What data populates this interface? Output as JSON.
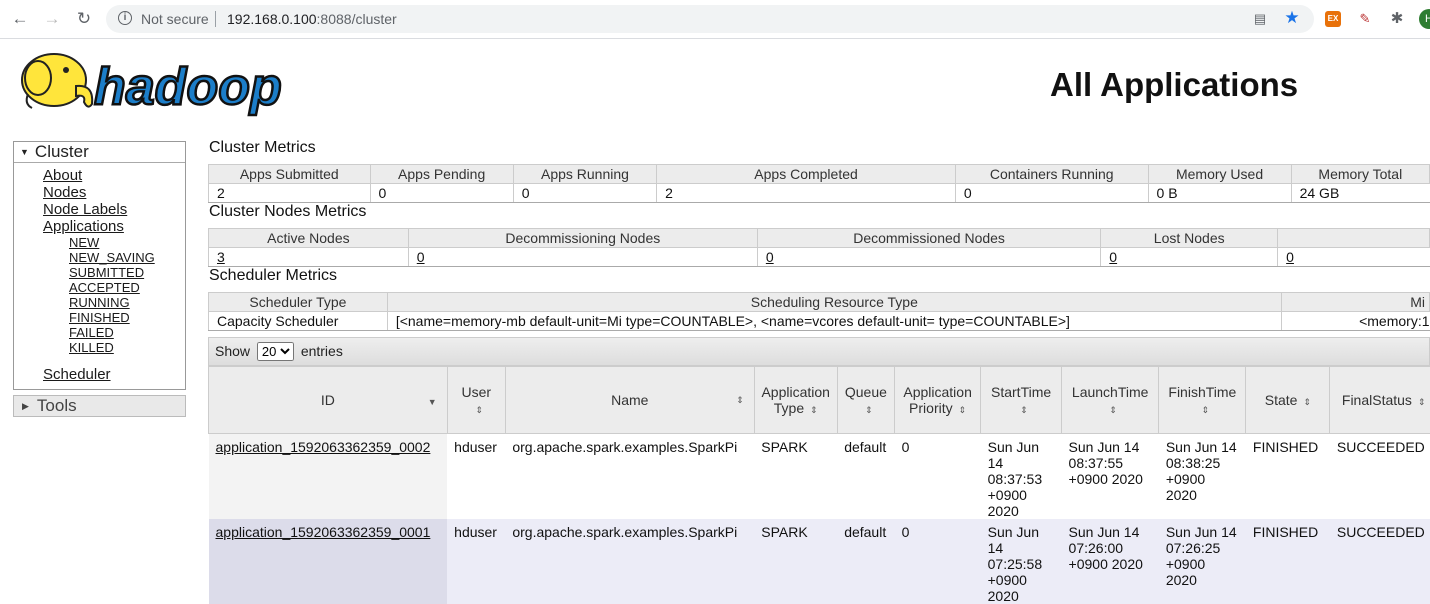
{
  "browser": {
    "security_label": "Not secure",
    "url_host": "192.168.0.100",
    "url_rest": ":8088/cluster",
    "icons": [
      "back-icon",
      "forward-icon",
      "reload-icon",
      "info-icon",
      "translate-icon",
      "star-icon",
      "extension-ex-icon",
      "pdf-icon",
      "puzzle-icon",
      "profile-avatar"
    ]
  },
  "page": {
    "title": "All Applications"
  },
  "sidebar": {
    "cluster_label": "Cluster",
    "links": [
      "About",
      "Nodes",
      "Node Labels",
      "Applications"
    ],
    "app_states": [
      "NEW",
      "NEW_SAVING",
      "SUBMITTED",
      "ACCEPTED",
      "RUNNING",
      "FINISHED",
      "FAILED",
      "KILLED"
    ],
    "scheduler_label": "Scheduler",
    "tools_label": "Tools"
  },
  "cluster_metrics": {
    "title": "Cluster Metrics",
    "headers": [
      "Apps Submitted",
      "Apps Pending",
      "Apps Running",
      "Apps Completed",
      "Containers Running",
      "Memory Used",
      "Memory Total"
    ],
    "values": [
      "2",
      "0",
      "0",
      "2",
      "0",
      "0 B",
      "24 GB"
    ]
  },
  "nodes_metrics": {
    "title": "Cluster Nodes Metrics",
    "headers": [
      "Active Nodes",
      "Decommissioning Nodes",
      "Decommissioned Nodes",
      "Lost Nodes",
      ""
    ],
    "values": [
      "3",
      "0",
      "0",
      "0",
      "0"
    ]
  },
  "scheduler_metrics": {
    "title": "Scheduler Metrics",
    "headers": [
      "Scheduler Type",
      "Scheduling Resource Type",
      "Mi"
    ],
    "values": [
      "Capacity Scheduler",
      "[<name=memory-mb default-unit=Mi type=COUNTABLE>, <name=vcores default-unit= type=COUNTABLE>]",
      "<memory:1"
    ]
  },
  "apps_table": {
    "show_label": "Show",
    "entries_label": "entries",
    "page_size": "20",
    "columns": [
      "ID",
      "User",
      "Name",
      "Application Type",
      "Queue",
      "Application Priority",
      "StartTime",
      "LaunchTime",
      "FinishTime",
      "State",
      "FinalStatus"
    ],
    "rows": [
      {
        "id": "application_1592063362359_0002",
        "user": "hduser",
        "name": "org.apache.spark.examples.SparkPi",
        "type": "SPARK",
        "queue": "default",
        "priority": "0",
        "start": "Sun Jun 14 08:37:53 +0900 2020",
        "launch": "Sun Jun 14 08:37:55 +0900 2020",
        "finish": "Sun Jun 14 08:38:25 +0900 2020",
        "state": "FINISHED",
        "final": "SUCCEEDED"
      },
      {
        "id": "application_1592063362359_0001",
        "user": "hduser",
        "name": "org.apache.spark.examples.SparkPi",
        "type": "SPARK",
        "queue": "default",
        "priority": "0",
        "start": "Sun Jun 14 07:25:58 +0900 2020",
        "launch": "Sun Jun 14 07:26:00 +0900 2020",
        "finish": "Sun Jun 14 07:26:25 +0900 2020",
        "state": "FINISHED",
        "final": "SUCCEEDED"
      }
    ]
  },
  "logo_text": "hadoop"
}
